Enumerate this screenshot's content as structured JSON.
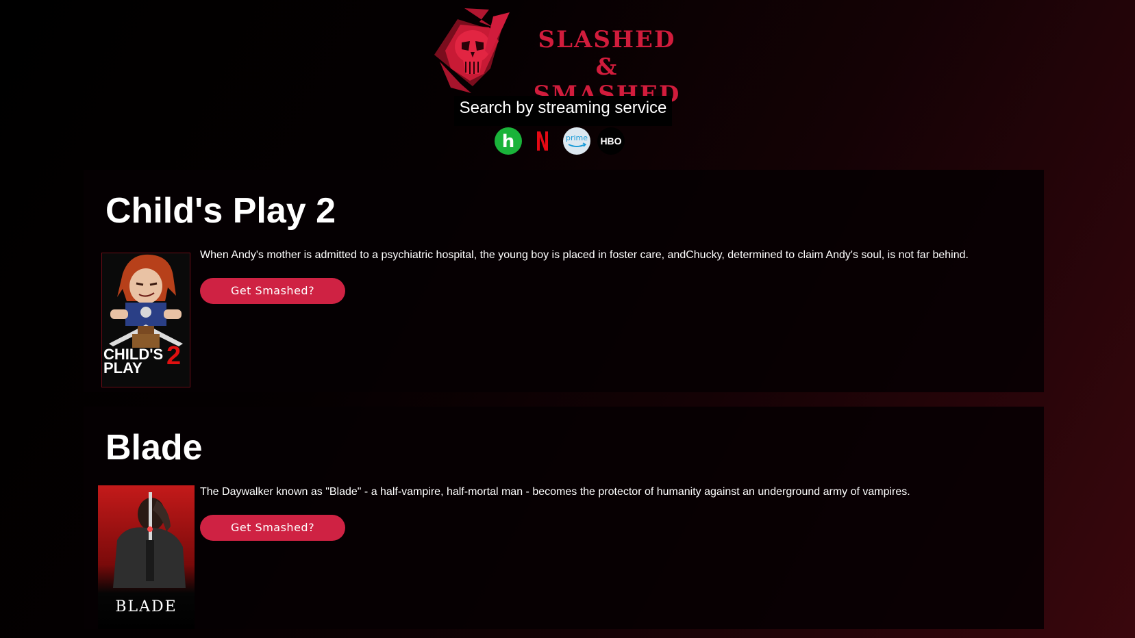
{
  "brand": {
    "name_line1": "SLASHED &",
    "name_line2": "SMASHED",
    "accent_color": "#d11c3c"
  },
  "search": {
    "label": "Search by streaming service",
    "services": [
      {
        "name": "Hulu",
        "icon": "hulu-icon",
        "glyph": "h",
        "color": "#1ab33a"
      },
      {
        "name": "Netflix",
        "icon": "netflix-icon",
        "glyph": "N",
        "color": "#e50914"
      },
      {
        "name": "Prime Video",
        "icon": "prime-video-icon",
        "glyph": "prime",
        "color": "#00a8e1"
      },
      {
        "name": "HBO",
        "icon": "hbo-icon",
        "glyph": "HBO",
        "color": "#000000"
      }
    ]
  },
  "movies": [
    {
      "title": "Child's Play 2",
      "description": "When Andy's mother is admitted to a psychiatric hospital, the young boy is placed in foster care, andChucky, determined to claim Andy's soul, is not far behind.",
      "button_label": "Get Smashed?",
      "poster_text": [
        "CHILD'S",
        "PLAY",
        "2"
      ]
    },
    {
      "title": "Blade",
      "description": "The Daywalker known as \"Blade\" - a half-vampire, half-mortal man - becomes the protector of humanity against an underground army of vampires.",
      "button_label": "Get Smashed?",
      "poster_text": [
        "BLADE"
      ]
    }
  ],
  "colors": {
    "button": "#cf2243",
    "card_background": "#060002"
  }
}
